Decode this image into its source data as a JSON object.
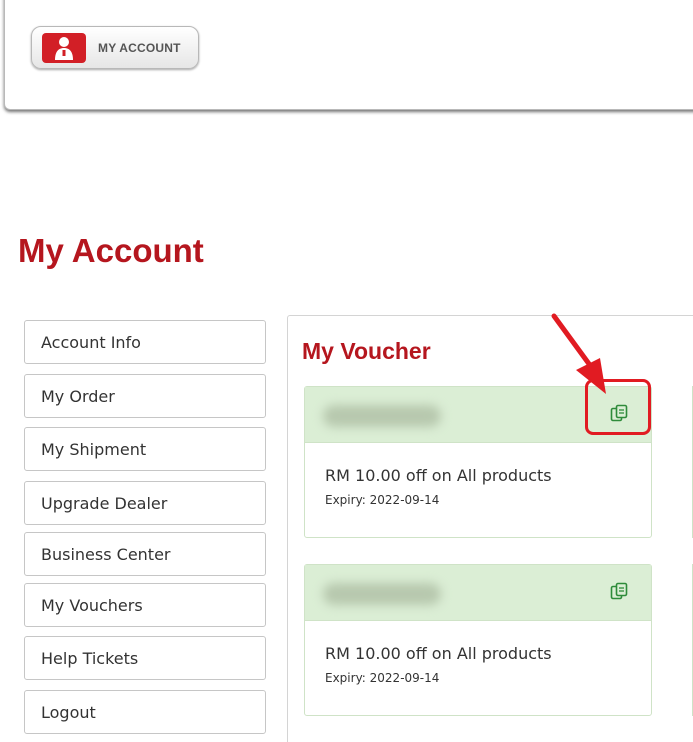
{
  "header": {
    "account_button_label": "MY ACCOUNT",
    "account_icon": "user-icon"
  },
  "page": {
    "title": "My Account"
  },
  "sidebar": {
    "items": [
      {
        "label": "Account Info"
      },
      {
        "label": "My Order"
      },
      {
        "label": "My Shipment"
      },
      {
        "label": "Upgrade Dealer"
      },
      {
        "label": "Business Center"
      },
      {
        "label": "My Vouchers"
      },
      {
        "label": "Help Tickets"
      },
      {
        "label": "Logout"
      }
    ]
  },
  "vouchers": {
    "title": "My Voucher",
    "items": [
      {
        "description": "RM 10.00 off on All products",
        "expiry": "Expiry: 2022-09-14",
        "copy_icon": "copy-icon"
      },
      {
        "description": "RM 10.00 off on All products",
        "expiry": "Expiry: 2022-09-14",
        "copy_icon": "copy-icon"
      }
    ]
  },
  "colors": {
    "accent_red": "#b5161e",
    "voucher_header_green": "#dbeed5",
    "annotation_red": "#e11b22"
  }
}
